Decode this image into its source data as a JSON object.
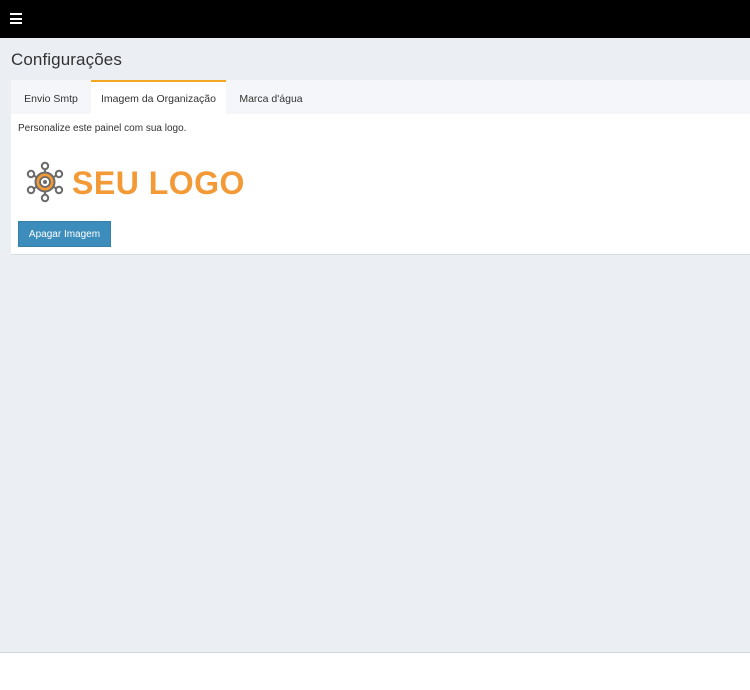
{
  "header": {
    "menu_icon": "hamburger-icon"
  },
  "page": {
    "title": "Configurações"
  },
  "tabs": [
    {
      "label": "Envio Smtp",
      "active": false
    },
    {
      "label": "Imagem da Organização",
      "active": true
    },
    {
      "label": "Marca d'água",
      "active": false
    }
  ],
  "organization_image": {
    "description": "Personalize este painel com sua logo.",
    "logo_text": "SEU LOGO",
    "logo_icon": "network-gear-icon",
    "delete_button": "Apagar Imagem"
  },
  "colors": {
    "topbar": "#000000",
    "content_bg": "#ebeef3",
    "tab_active_border": "#f5a623",
    "logo_orange": "#f39a37",
    "logo_gray": "#6b6b6b",
    "button_blue": "#3c8dbc"
  }
}
